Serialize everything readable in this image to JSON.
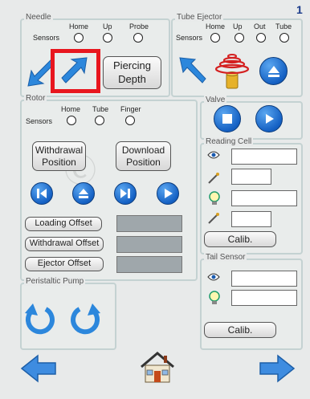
{
  "page_number": "1",
  "needle": {
    "title": "Needle",
    "sensors_label": "Sensors",
    "sensor_names": [
      "Home",
      "Up",
      "Probe"
    ],
    "piercing_depth_label": "Piercing\nDepth"
  },
  "tube_ejector": {
    "title": "Tube Ejector",
    "sensors_label": "Sensors",
    "sensor_names": [
      "Home",
      "Up",
      "Out",
      "Tube"
    ]
  },
  "rotor": {
    "title": "Rotor",
    "sensors_label": "Sensors",
    "sensor_names": [
      "Home",
      "Tube",
      "Finger"
    ],
    "withdrawal_position_label": "Withdrawal\nPosition",
    "download_position_label": "Download\nPosition",
    "loading_offset_label": "Loading Offset",
    "withdrawal_offset_label": "Withdrawal Offset",
    "ejector_offset_label": "Ejector Offset"
  },
  "valve": {
    "title": "Valve"
  },
  "reading_cell": {
    "title": "Reading Cell",
    "calib_label": "Calib."
  },
  "tail_sensor": {
    "title": "Tail Sensor",
    "calib_label": "Calib."
  },
  "peristaltic_pump": {
    "title": "Peristaltic Pump"
  },
  "colors": {
    "accent_blue": "#1a6fd1",
    "highlight_red": "#e8161e"
  }
}
